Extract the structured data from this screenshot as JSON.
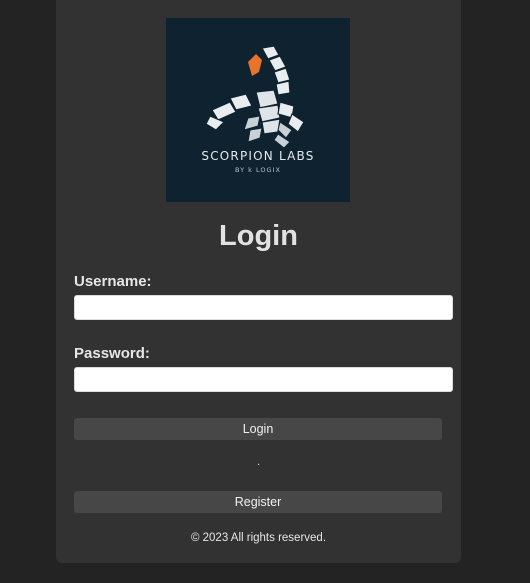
{
  "logo": {
    "title": "SCORPION LABS",
    "subtitle": "BY k LOGIX",
    "icon": "scorpion-icon",
    "background": "#0e2230",
    "accent": "#e8732a"
  },
  "form": {
    "heading": "Login",
    "username_label": "Username:",
    "username_value": "",
    "password_label": "Password:",
    "password_value": "",
    "login_button": "Login",
    "separator": ".",
    "register_button": "Register"
  },
  "footer": {
    "copyright": "© 2023 All rights reserved."
  }
}
